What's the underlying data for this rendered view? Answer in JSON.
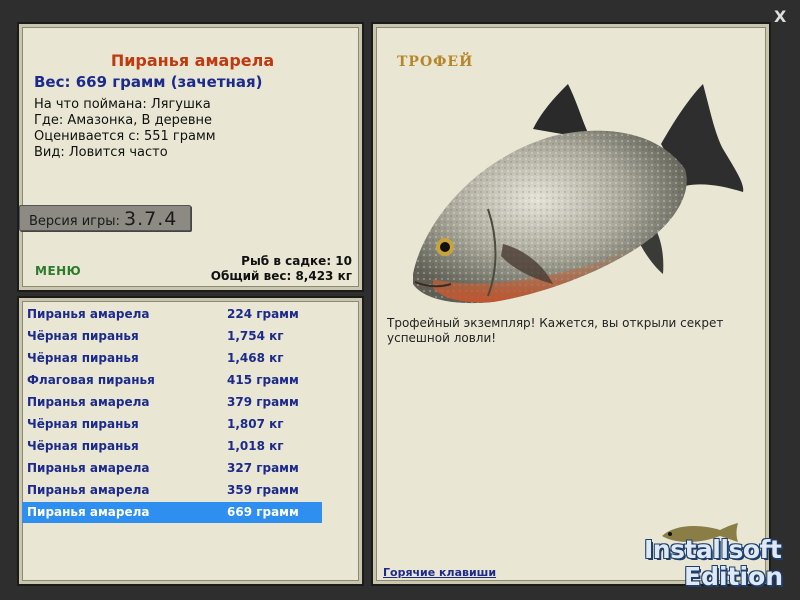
{
  "info": {
    "title": "Пиранья амарела",
    "weight": "Вес: 669 грамм (зачетная)",
    "caught_with": "На что поймана: Лягушка",
    "where": "Где: Амазонка, В деревне",
    "valued_from": "Оценивается с: 551 грамм",
    "kind": "Вид: Ловится часто",
    "version_label": "Версия игры:",
    "version_number": "3.7.4",
    "menu_label": "МЕНЮ",
    "fish_count": "Рыб в садке: 10",
    "total_weight": "Общий вес: 8,423 кг"
  },
  "catch_list": [
    {
      "name": "Пиранья амарела",
      "weight": "224 грамм"
    },
    {
      "name": "Чёрная пиранья",
      "weight": "1,754 кг"
    },
    {
      "name": "Чёрная пиранья",
      "weight": "1,468 кг"
    },
    {
      "name": "Флаговая пиранья",
      "weight": "415 грамм"
    },
    {
      "name": "Пиранья амарела",
      "weight": "379 грамм"
    },
    {
      "name": "Чёрная пиранья",
      "weight": "1,807 кг"
    },
    {
      "name": "Чёрная пиранья",
      "weight": "1,018 кг"
    },
    {
      "name": "Пиранья амарела",
      "weight": "327 грамм"
    },
    {
      "name": "Пиранья амарела",
      "weight": "359 грамм"
    },
    {
      "name": "Пиранья амарела",
      "weight": "669 грамм"
    }
  ],
  "selected_index": 9,
  "trophy": {
    "title": "ТРОФЕЙ",
    "text": "Трофейный экземпляр! Кажется, вы открыли секрет успешной ловли!",
    "hotkeys_label": "Горячие клавиши"
  },
  "close_label": "X",
  "brand": {
    "line1": "Installsoft",
    "line2": "Edition"
  },
  "colors": {
    "title": "#c0390f",
    "list_text": "#1b2a8c",
    "selection": "#2f8ff0",
    "trophy_label": "#b6862a",
    "menu": "#2c7a2a"
  }
}
